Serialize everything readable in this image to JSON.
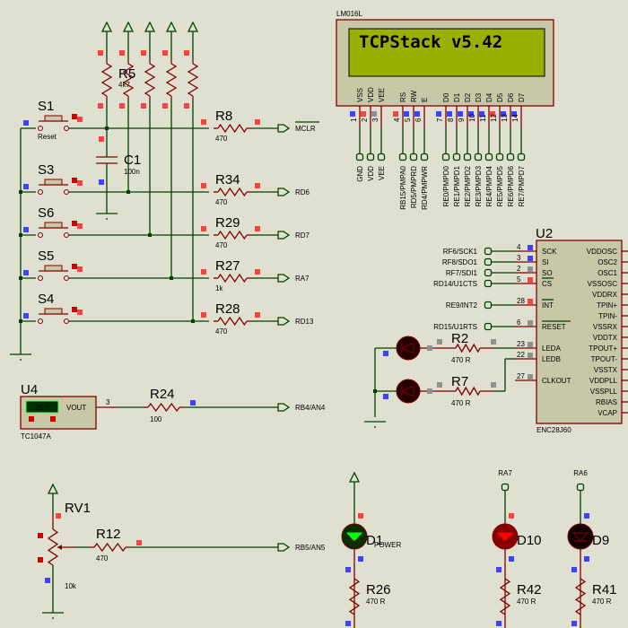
{
  "colors": {
    "background": "#e0e0d1",
    "wire": "#004000",
    "component": "#800000",
    "lcd_screen": "#99b000",
    "pin_red": "#ff4040",
    "pin_blue": "#4040ff",
    "pin_gray": "#909090"
  },
  "pullups": {
    "label": "R5",
    "value": "4k7"
  },
  "capacitor": {
    "label": "C1",
    "value": "100n"
  },
  "switches": [
    {
      "label": "S1",
      "caption": "Reset",
      "resistor": "R8",
      "value": "470",
      "net": "MCLR"
    },
    {
      "label": "S3",
      "caption": "",
      "resistor": "R34",
      "value": "470",
      "net": "RD6"
    },
    {
      "label": "S6",
      "caption": "",
      "resistor": "R29",
      "value": "470",
      "net": "RD7"
    },
    {
      "label": "S5",
      "caption": "",
      "resistor": "R27",
      "value": "1k",
      "net": "RA7"
    },
    {
      "label": "S4",
      "caption": "",
      "resistor": "R28",
      "value": "470",
      "net": "RD13"
    }
  ],
  "lcd": {
    "part": "LM016L",
    "text": "TCPStack v5.42",
    "pins": [
      {
        "num": "1",
        "name": "VSS",
        "net": "GND"
      },
      {
        "num": "2",
        "name": "VDD",
        "net": "VDD"
      },
      {
        "num": "3",
        "name": "VEE",
        "net": "VEE"
      },
      {
        "num": "4",
        "name": "RS",
        "net": "RB15/PMPA0"
      },
      {
        "num": "5",
        "name": "RW",
        "net": "RD5/PMPRD"
      },
      {
        "num": "6",
        "name": "E",
        "net": "RD4/PMPWR"
      },
      {
        "num": "7",
        "name": "D0",
        "net": "RE0/PMPD0"
      },
      {
        "num": "8",
        "name": "D1",
        "net": "RE1/PMPD1"
      },
      {
        "num": "9",
        "name": "D2",
        "net": "RE2/PMPD2"
      },
      {
        "num": "10",
        "name": "D3",
        "net": "RE3/PMPD3"
      },
      {
        "num": "11",
        "name": "D4",
        "net": "RE4/PMPD4"
      },
      {
        "num": "12",
        "name": "D5",
        "net": "RE5/PMPD5"
      },
      {
        "num": "13",
        "name": "D6",
        "net": "RE6/PMPD6"
      },
      {
        "num": "14",
        "name": "D7",
        "net": "RE7/PMPD7"
      }
    ]
  },
  "enc": {
    "label": "U2",
    "part": "ENC28J60",
    "left_pins": [
      {
        "num": "4",
        "name": "SCK",
        "net": "RF6/SCK1"
      },
      {
        "num": "3",
        "name": "SI",
        "net": "RF8/SDO1"
      },
      {
        "num": "2",
        "name": "SO",
        "net": "RF7/SDI1"
      },
      {
        "num": "5",
        "name": "CS",
        "net": "RD14/U1CTS"
      },
      {
        "num": "28",
        "name": "INT",
        "net": "RE9/INT2"
      },
      {
        "num": "6",
        "name": "RESET",
        "net": "RD15/U1RTS"
      },
      {
        "num": "23",
        "name": "LEDA",
        "net": ""
      },
      {
        "num": "22",
        "name": "LEDB",
        "net": ""
      },
      {
        "num": "27",
        "name": "CLKOUT",
        "net": ""
      }
    ],
    "right_pins": [
      "VDDOSC",
      "OSC2",
      "OSC1",
      "VSSOSC",
      "VDDRX",
      "TPIN+",
      "TPIN-",
      "VSSRX",
      "VDDTX",
      "TPOUT+",
      "TPOUT-",
      "VSSTX",
      "VDDPLL",
      "VSSPLL",
      "RBIAS",
      "VCAP"
    ],
    "led_resistors": [
      {
        "label": "R2",
        "value": "470 R"
      },
      {
        "label": "R7",
        "value": "470 R"
      }
    ]
  },
  "sensor": {
    "label": "U4",
    "part": "TC1047A",
    "reading": "25.0",
    "pin_name": "VOUT",
    "pin_num": "3",
    "resistor": "R24",
    "value": "100",
    "net": "RB4/AN4"
  },
  "pot": {
    "label": "RV1",
    "value": "10k",
    "resistor": "R12",
    "r_value": "470",
    "net": "RB5/AN5"
  },
  "leds": [
    {
      "label": "D1",
      "caption": "POWER",
      "net": "",
      "color": "#00ff00",
      "state": "on",
      "resistor": "R26",
      "value": "470 R"
    },
    {
      "label": "D10",
      "caption": "",
      "net": "RA7",
      "color": "#ff0000",
      "state": "on",
      "resistor": "R42",
      "value": "470 R"
    },
    {
      "label": "D9",
      "caption": "",
      "net": "RA6",
      "color": "#000000",
      "state": "off",
      "resistor": "R41",
      "value": "470 R"
    }
  ]
}
